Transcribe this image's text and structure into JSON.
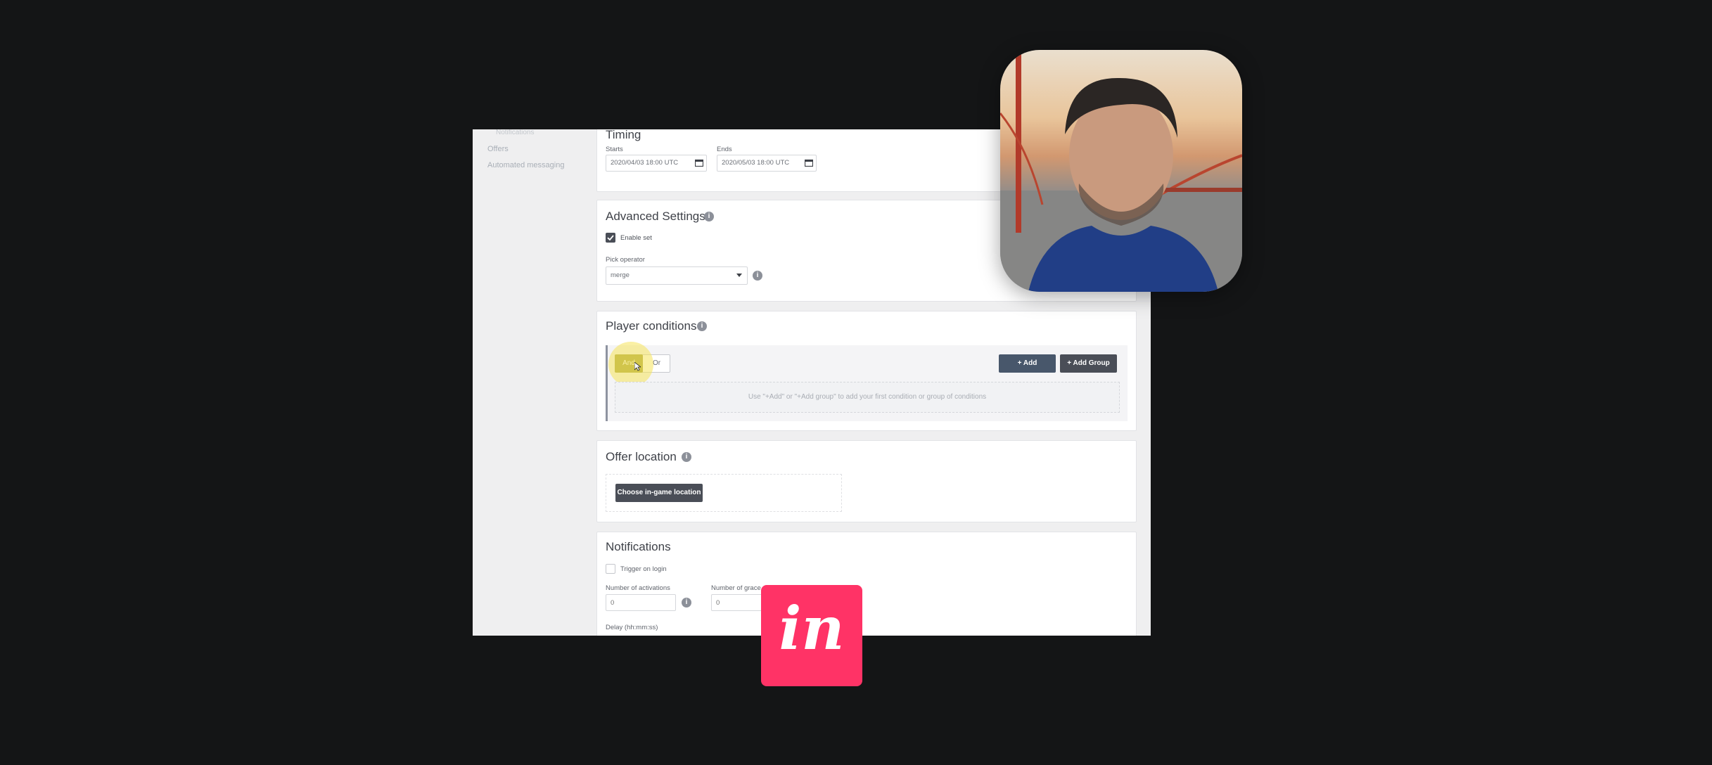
{
  "sidebar": {
    "items": [
      {
        "label": "Notifications"
      },
      {
        "label": "Offers"
      },
      {
        "label": "Automated messaging"
      }
    ]
  },
  "timing": {
    "title": "Timing",
    "starts_label": "Starts",
    "starts_value": "2020/04/03 18:00 UTC",
    "ends_label": "Ends",
    "ends_value": "2020/05/03 18:00 UTC"
  },
  "advanced": {
    "title": "Advanced Settings",
    "enable_set_label": "Enable set",
    "enable_set_checked": true,
    "operator_label": "Pick operator",
    "operator_value": "merge"
  },
  "player_conditions": {
    "title": "Player conditions",
    "and_label": "And",
    "or_label": "Or",
    "add_label": "+ Add",
    "add_group_label": "+ Add Group",
    "empty_hint": "Use \"+Add\" or \"+Add group\" to add your first condition or group of conditions"
  },
  "offer_location": {
    "title": "Offer location",
    "button_label": "Choose in-game location"
  },
  "notifications": {
    "title": "Notifications",
    "trigger_label": "Trigger on login",
    "trigger_checked": false,
    "activations_label": "Number of activations",
    "activations_placeholder": "0",
    "grace_label": "Number of grace",
    "grace_placeholder": "0",
    "delay_label": "Delay (hh:mm:ss)"
  },
  "logo": {
    "text": "in"
  },
  "colors": {
    "accent_dark": "#4a4e57",
    "add_button": "#48576b",
    "and_toggle": "#a4a03a",
    "brand_logo": "#ff3366"
  },
  "icons": {
    "info": "info-icon",
    "calendar": "calendar-icon",
    "dropdown": "chevron-down-icon",
    "check": "check-icon"
  }
}
